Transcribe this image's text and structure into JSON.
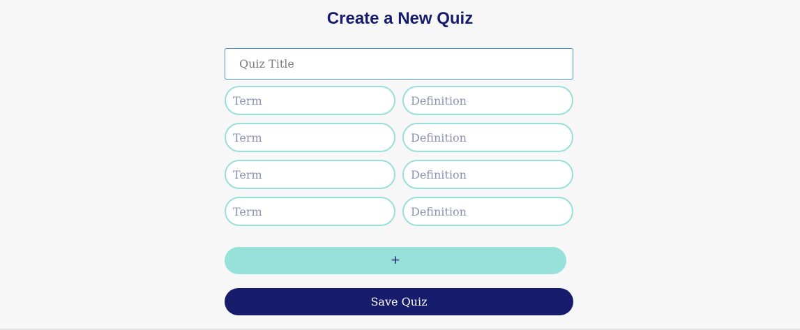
{
  "header": {
    "title": "Create a New Quiz"
  },
  "form": {
    "title_placeholder": "Quiz Title",
    "title_value": "",
    "pairs": [
      {
        "term_placeholder": "Term",
        "definition_placeholder": "Definition"
      },
      {
        "term_placeholder": "Term",
        "definition_placeholder": "Definition"
      },
      {
        "term_placeholder": "Term",
        "definition_placeholder": "Definition"
      },
      {
        "term_placeholder": "Term",
        "definition_placeholder": "Definition"
      }
    ]
  },
  "actions": {
    "add_label": "+",
    "save_label": "Save Quiz"
  },
  "colors": {
    "background": "#f7f7f7",
    "primary": "#161b6b",
    "accent": "#98e0da",
    "input_border": "#99dfd9",
    "focus_border": "#4a90c2"
  }
}
